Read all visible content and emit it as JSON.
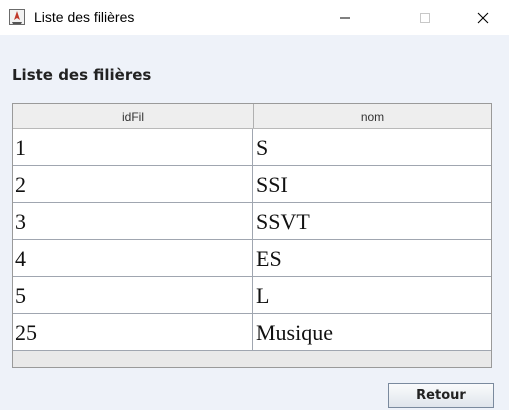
{
  "window": {
    "title": "Liste des filières",
    "icon": "java-app-icon",
    "controls": [
      "minimize-icon",
      "maximize-icon",
      "close-icon"
    ]
  },
  "heading": "Liste des filières",
  "table": {
    "columns": [
      "idFil",
      "nom"
    ],
    "rows": [
      {
        "idFil": "1",
        "nom": "S"
      },
      {
        "idFil": "2",
        "nom": "SSI"
      },
      {
        "idFil": "3",
        "nom": "SSVT"
      },
      {
        "idFil": "4",
        "nom": "ES"
      },
      {
        "idFil": "5",
        "nom": "L"
      },
      {
        "idFil": "25",
        "nom": "Musique"
      }
    ]
  },
  "buttons": {
    "retour": "Retour"
  }
}
